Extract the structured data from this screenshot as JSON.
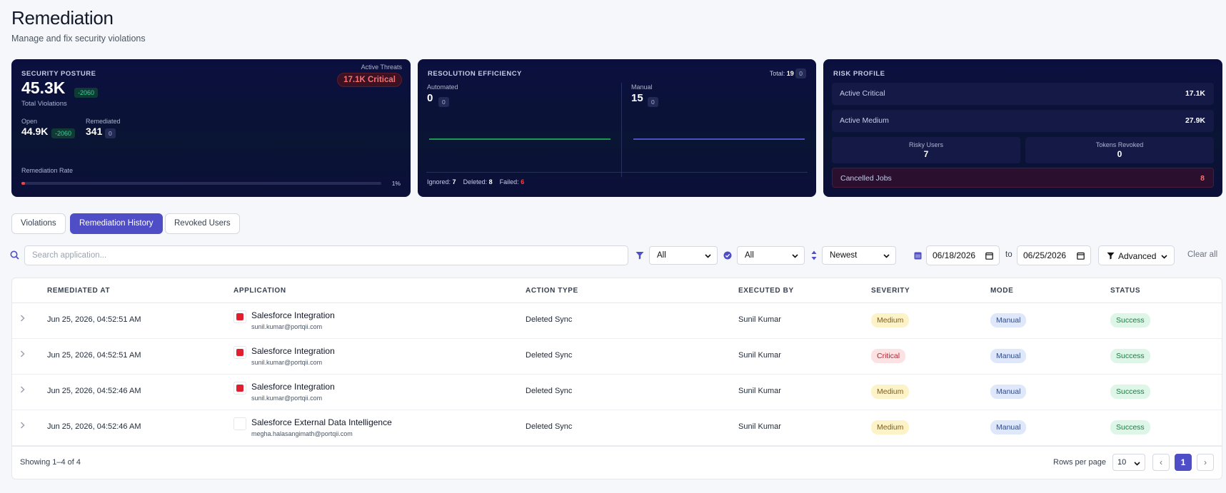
{
  "page": {
    "title": "Remediation",
    "subtitle": "Manage and fix security violations"
  },
  "security_posture": {
    "label": "SECURITY POSTURE",
    "total": "45.3K",
    "total_delta": "-2060",
    "total_label": "Total Violations",
    "active_threats_label": "Active Threats",
    "active_threats_value": "17.1K Critical",
    "open_label": "Open",
    "open_value": "44.9K",
    "open_delta": "-2060",
    "remediated_label": "Remediated",
    "remediated_value": "341",
    "remediated_delta": "0",
    "rate_label": "Remediation Rate",
    "rate_value": "1%",
    "rate_fraction": 0.01
  },
  "resolution_efficiency": {
    "label": "RESOLUTION EFFICIENCY",
    "total_label": "Total:",
    "total_value": "19",
    "total_delta": "0",
    "automated_label": "Automated",
    "automated_value": "0",
    "automated_delta": "0",
    "manual_label": "Manual",
    "manual_value": "15",
    "manual_delta": "0",
    "ignored_label": "Ignored:",
    "ignored_value": "7",
    "deleted_label": "Deleted:",
    "deleted_value": "8",
    "failed_label": "Failed:",
    "failed_value": "6",
    "colors": {
      "automated": "#22c55e",
      "manual": "#6366f1",
      "failed": "#ef4444"
    }
  },
  "risk_profile": {
    "label": "RISK PROFILE",
    "active_critical_label": "Active Critical",
    "active_critical_value": "17.1K",
    "active_medium_label": "Active Medium",
    "active_medium_value": "27.9K",
    "risky_users_label": "Risky Users",
    "risky_users_value": "7",
    "tokens_revoked_label": "Tokens Revoked",
    "tokens_revoked_value": "0",
    "cancelled_jobs_label": "Cancelled Jobs",
    "cancelled_jobs_value": "8"
  },
  "tabs": [
    {
      "label": "Violations",
      "active": false
    },
    {
      "label": "Remediation History",
      "active": true
    },
    {
      "label": "Revoked Users",
      "active": false
    }
  ],
  "filters": {
    "search_placeholder": "Search application...",
    "filter_value": "All",
    "status_value": "All",
    "sort_value": "Newest",
    "date_from": "06/18/2026",
    "to_label": "to",
    "date_to": "06/25/2026",
    "advanced_label": "Advanced",
    "clear_all_label": "Clear all"
  },
  "table": {
    "columns": [
      "REMEDIATED AT",
      "APPLICATION",
      "ACTION TYPE",
      "EXECUTED BY",
      "SEVERITY",
      "MODE",
      "STATUS"
    ],
    "rows": [
      {
        "remediated_at": "Jun 25, 2026, 04:52:51 AM",
        "app": "Salesforce Integration",
        "email": "sunil.kumar@portqii.com",
        "action": "Deleted Sync",
        "executed_by": "Sunil Kumar",
        "severity": "Medium",
        "mode": "Manual",
        "status": "Success",
        "icon": "salesforce-icon"
      },
      {
        "remediated_at": "Jun 25, 2026, 04:52:51 AM",
        "app": "Salesforce Integration",
        "email": "sunil.kumar@portqii.com",
        "action": "Deleted Sync",
        "executed_by": "Sunil Kumar",
        "severity": "Critical",
        "mode": "Manual",
        "status": "Success",
        "icon": "salesforce-icon"
      },
      {
        "remediated_at": "Jun 25, 2026, 04:52:46 AM",
        "app": "Salesforce Integration",
        "email": "sunil.kumar@portqii.com",
        "action": "Deleted Sync",
        "executed_by": "Sunil Kumar",
        "severity": "Medium",
        "mode": "Manual",
        "status": "Success",
        "icon": "salesforce-icon"
      },
      {
        "remediated_at": "Jun 25, 2026, 04:52:46 AM",
        "app": "Salesforce External Data Intelligence",
        "email": "megha.halasangimath@portqii.com",
        "action": "Deleted Sync",
        "executed_by": "Sunil Kumar",
        "severity": "Medium",
        "mode": "Manual",
        "status": "Success",
        "icon": "blank-app-icon"
      }
    ]
  },
  "pagination": {
    "showing": "Showing 1–4 of 4",
    "rows_per_page_label": "Rows per page",
    "rows_per_page": "10",
    "current_page": "1"
  }
}
